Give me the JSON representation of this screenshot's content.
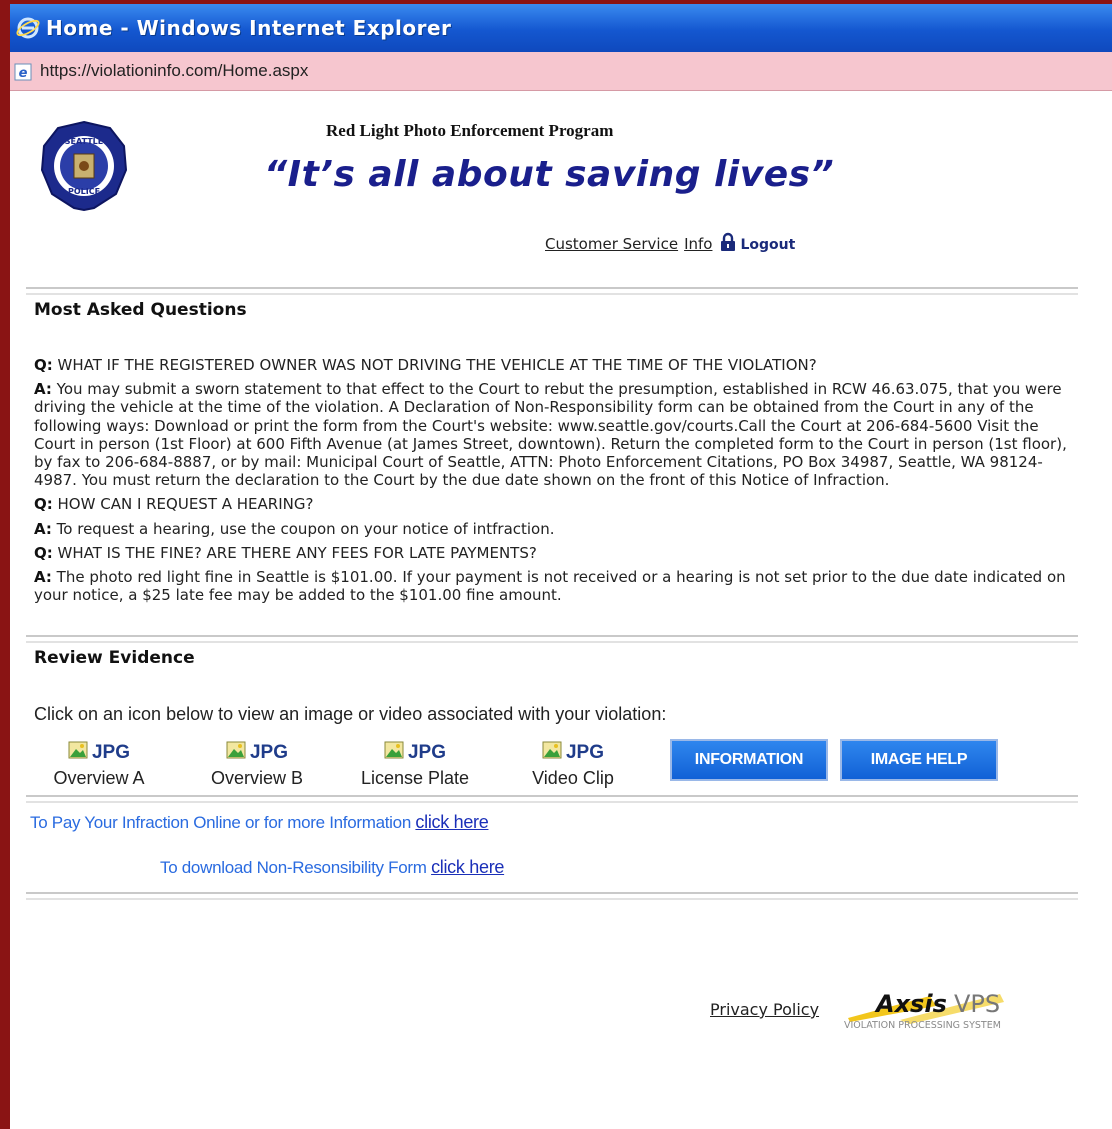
{
  "window": {
    "title": "Home - Windows Internet Explorer",
    "url": "https://violationinfo.com/Home.aspx"
  },
  "header": {
    "program_title": "Red Light Photo Enforcement Program",
    "slogan": "“It’s all about saving lives”",
    "seal_text_top": "SEATTLE",
    "seal_text_bottom": "POLICE"
  },
  "topnav": {
    "customer_service": "Customer Service",
    "info": "Info",
    "logout": "Logout"
  },
  "faq": {
    "section_title": "Most Asked Questions",
    "q_label": "Q:",
    "a_label": "A:",
    "items": [
      {
        "q": "WHAT IF THE REGISTERED OWNER WAS NOT DRIVING THE VEHICLE AT THE TIME OF THE VIOLATION?",
        "a": "You may submit a sworn statement to that effect to the Court to rebut the presumption, established in RCW 46.63.075, that you were driving the vehicle at the time of the violation. A Declaration of Non-Responsibility form can be obtained from the Court in any of the following ways: Download or print the form from the Court's website: www.seattle.gov/courts.Call the Court at 206-684-5600 Visit the Court in person (1st Floor) at 600 Fifth Avenue (at James Street, downtown). Return the completed form to the Court in person (1st floor), by fax to 206-684-8887, or by mail: Municipal Court of Seattle, ATTN: Photo Enforcement Citations, PO Box 34987, Seattle, WA 98124-4987. You must return the declaration to the Court by the due date shown on the front of this Notice of Infraction."
      },
      {
        "q": "HOW CAN I REQUEST A HEARING?",
        "a": "To request a hearing, use the coupon on your notice of intfraction."
      },
      {
        "q": "WHAT IS THE FINE? ARE THERE ANY FEES FOR LATE PAYMENTS?",
        "a": "The photo red light fine in Seattle is $101.00. If your payment is not received or a hearing is not set prior to the due date indicated on your notice, a $25 late fee may be added to the $101.00 fine amount."
      }
    ]
  },
  "evidence": {
    "section_title": "Review Evidence",
    "instruction": "Click on an icon below to view an image or video associated with your violation:",
    "items": [
      {
        "type": "JPG",
        "caption": "Overview A"
      },
      {
        "type": "JPG",
        "caption": "Overview B"
      },
      {
        "type": "JPG",
        "caption": "License Plate"
      },
      {
        "type": "JPG",
        "caption": "Video Clip"
      }
    ],
    "buttons": {
      "information": "INFORMATION",
      "image_help": "IMAGE HELP"
    }
  },
  "links": {
    "pay_text": "To Pay Your Infraction Online or for more Information",
    "pay_link": "click here",
    "form_text": "To download Non-Resonsibility Form",
    "form_link": "click here"
  },
  "footer": {
    "privacy": "Privacy Policy",
    "brand_name": "Axsis",
    "brand_suffix": "VPS",
    "brand_tagline": "VIOLATION PROCESSING SYSTEM"
  },
  "colors": {
    "border": "#8a1414",
    "titlebar": "#1457d0",
    "addressbar": "#f6c6cf",
    "slogan": "#1a1f8c",
    "button": "#1161d6",
    "link": "#2a6be0"
  }
}
